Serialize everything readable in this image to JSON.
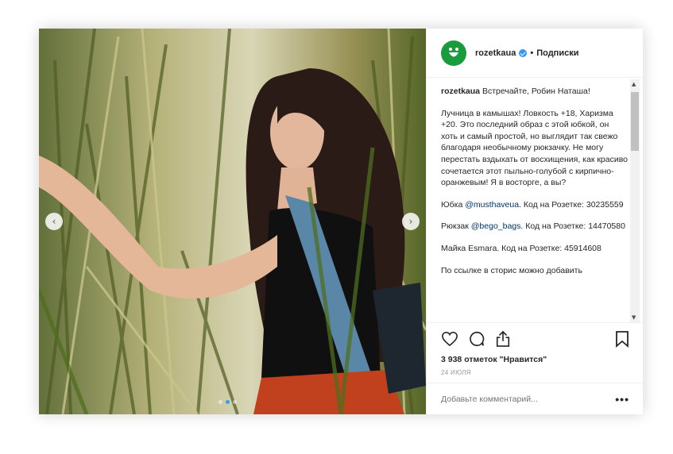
{
  "post": {
    "carousel": {
      "prev_icon": "chevron-left-icon",
      "next_icon": "chevron-right-icon",
      "dots_count": 3,
      "active_dot": 1
    },
    "header": {
      "username": "rozetkaua",
      "separator": "•",
      "follow_label": "Подписки",
      "verified_color": "#3897f0",
      "avatar_color": "#1a9c3e"
    },
    "caption": {
      "username": "rozetkaua",
      "intro": "Встречайте, Робин Наташа!",
      "paragraph1": "Лучница в камышах! Ловкость +18, Харизма +20. Это последний образ с этой юбкой, он хоть и самый простой, но выглядит так свежо благодаря необычному рюкзачку. Не могу перестать вздыхать от восхищения, как красиво сочетается этот пыльно-голубой с кирпично-оранжевым! Я в восторге, а вы?",
      "skirt_prefix": "Юбка ",
      "skirt_mention": "@musthaveua",
      "skirt_suffix": ". Код на Розетке: 30235559",
      "bag_prefix": "Рюкзак ",
      "bag_mention": "@bego_bags",
      "bag_suffix": ". Код на Розетке: 14470580",
      "top_line": "Майка Esmara. Код на Розетке: 45914608",
      "stories_line": "По ссылке в сторис можно добавить"
    },
    "actions": {
      "like_icon": "heart-icon",
      "comment_icon": "comment-icon",
      "share_icon": "share-icon",
      "save_icon": "bookmark-icon",
      "likes_text": "3 938 отметок \"Нравится\"",
      "date": "24 июля"
    },
    "comment": {
      "placeholder": "Добавьте комментарий...",
      "more_label": "•••"
    }
  }
}
